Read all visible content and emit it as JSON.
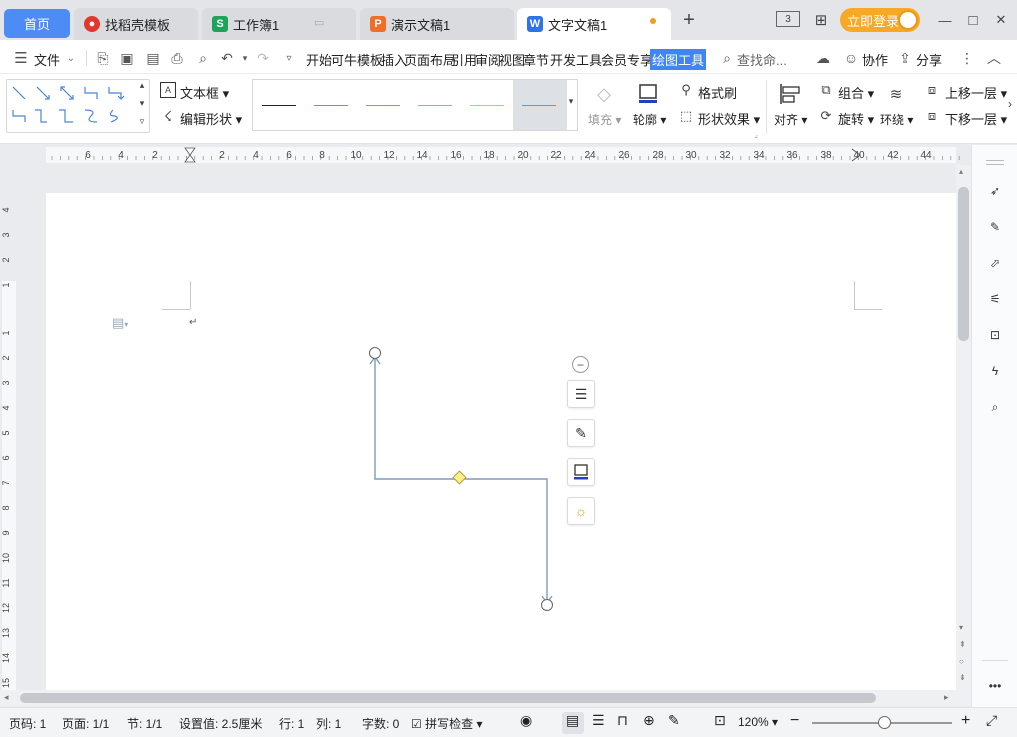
{
  "tabs": {
    "home": "首页",
    "items": [
      {
        "label": "找稻壳模板",
        "icon_color": "#e3362e",
        "icon_char": ""
      },
      {
        "label": "工作簿1",
        "icon_color": "#1ea35a",
        "icon_char": "S"
      },
      {
        "label": "演示文稿1",
        "icon_color": "#ee6e2a",
        "icon_char": "P"
      },
      {
        "label": "文字文稿1",
        "icon_color": "#2f74e6",
        "icon_char": "W"
      }
    ],
    "new_tab": "+"
  },
  "window": {
    "page_count_badge": "3",
    "login_label": "立即登录",
    "minimize": "—",
    "maximize": "□",
    "close": "✕"
  },
  "menu": {
    "file": "文件",
    "items": [
      "开始",
      "可牛模板",
      "插入",
      "页面布局",
      "引用",
      "审阅",
      "视图",
      "章节",
      "开发工具",
      "会员专享"
    ],
    "active": "绘图工具",
    "search": "查找命...",
    "collab": "协作",
    "share": "分享"
  },
  "ribbon": {
    "textbox": "文本框",
    "edit_shape": "编辑形状",
    "fill": "填充",
    "outline": "轮廓",
    "format_painter": "格式刷",
    "shape_effect": "形状效果",
    "align": "对齐",
    "group": "组合",
    "rotate": "旋转",
    "wrap": "环绕",
    "bring_forward": "上移一层",
    "send_backward": "下移一层",
    "line_colors": [
      "#222222",
      "#5b9bd5",
      "#ed7d31",
      "#8faadc",
      "#ffc000",
      "#5b9bd5"
    ]
  },
  "ruler": {
    "h_labels": [
      "6",
      "4",
      "2",
      "2",
      "4",
      "6",
      "8",
      "10",
      "12",
      "14",
      "16",
      "18",
      "20",
      "22",
      "24",
      "26",
      "28",
      "30",
      "32",
      "34",
      "36",
      "38",
      "40",
      "42",
      "44"
    ],
    "v_labels": [
      "4",
      "3",
      "2",
      "1",
      "1",
      "2",
      "3",
      "4",
      "5",
      "6",
      "7",
      "8",
      "9",
      "10",
      "11",
      "12",
      "13",
      "14",
      "15"
    ]
  },
  "status": {
    "page_num": "页码: 1",
    "pages": "页面: 1/1",
    "section": "节: 1/1",
    "setting": "设置值: 2.5厘米",
    "row": "行: 1",
    "col": "列: 1",
    "words": "字数: 0",
    "spell": "拼写检查",
    "zoom": "120%"
  },
  "colors": {
    "accent": "#3f86f4",
    "connector": "#7f9bb9",
    "handle": "#ffef8a"
  }
}
